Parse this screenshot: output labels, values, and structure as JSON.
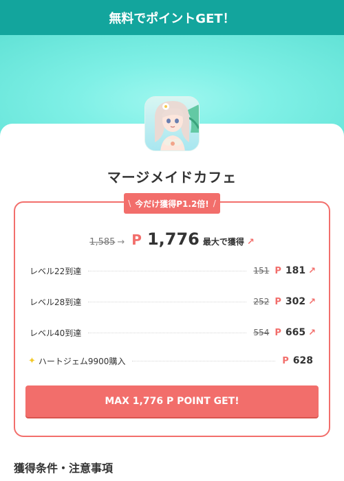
{
  "header": {
    "title": "無料でポイントGET！"
  },
  "app": {
    "name": "マージメイドカフェ",
    "icon": "app-icon-mermaid-girl"
  },
  "badge": {
    "slash_left": "\\",
    "label": "今だけ獲得P1.2倍!",
    "slash_right": "/"
  },
  "total": {
    "old": "1,585",
    "arrow": "→",
    "p_mark": "P",
    "new": "1,776",
    "note": "最大で獲得",
    "up_arrow": "↗"
  },
  "tasks": [
    {
      "label": "レベル22到達",
      "old": "151",
      "p_mark": "P",
      "new": "181",
      "up_arrow": "↗"
    },
    {
      "label": "レベル28到達",
      "old": "252",
      "p_mark": "P",
      "new": "302",
      "up_arrow": "↗"
    },
    {
      "label": "レベル40到達",
      "old": "554",
      "p_mark": "P",
      "new": "665",
      "up_arrow": "↗"
    },
    {
      "label": "ハートジェム9900購入",
      "icon": "sparkle-icon",
      "p_mark": "P",
      "new": "628"
    }
  ],
  "cta": {
    "label": "MAX 1,776 P POINT GET!"
  },
  "section": {
    "title": "獲得条件・注意事項"
  },
  "colors": {
    "header": "#13a59d",
    "accent": "#f26e6b",
    "hero": "#7ff0e6"
  }
}
